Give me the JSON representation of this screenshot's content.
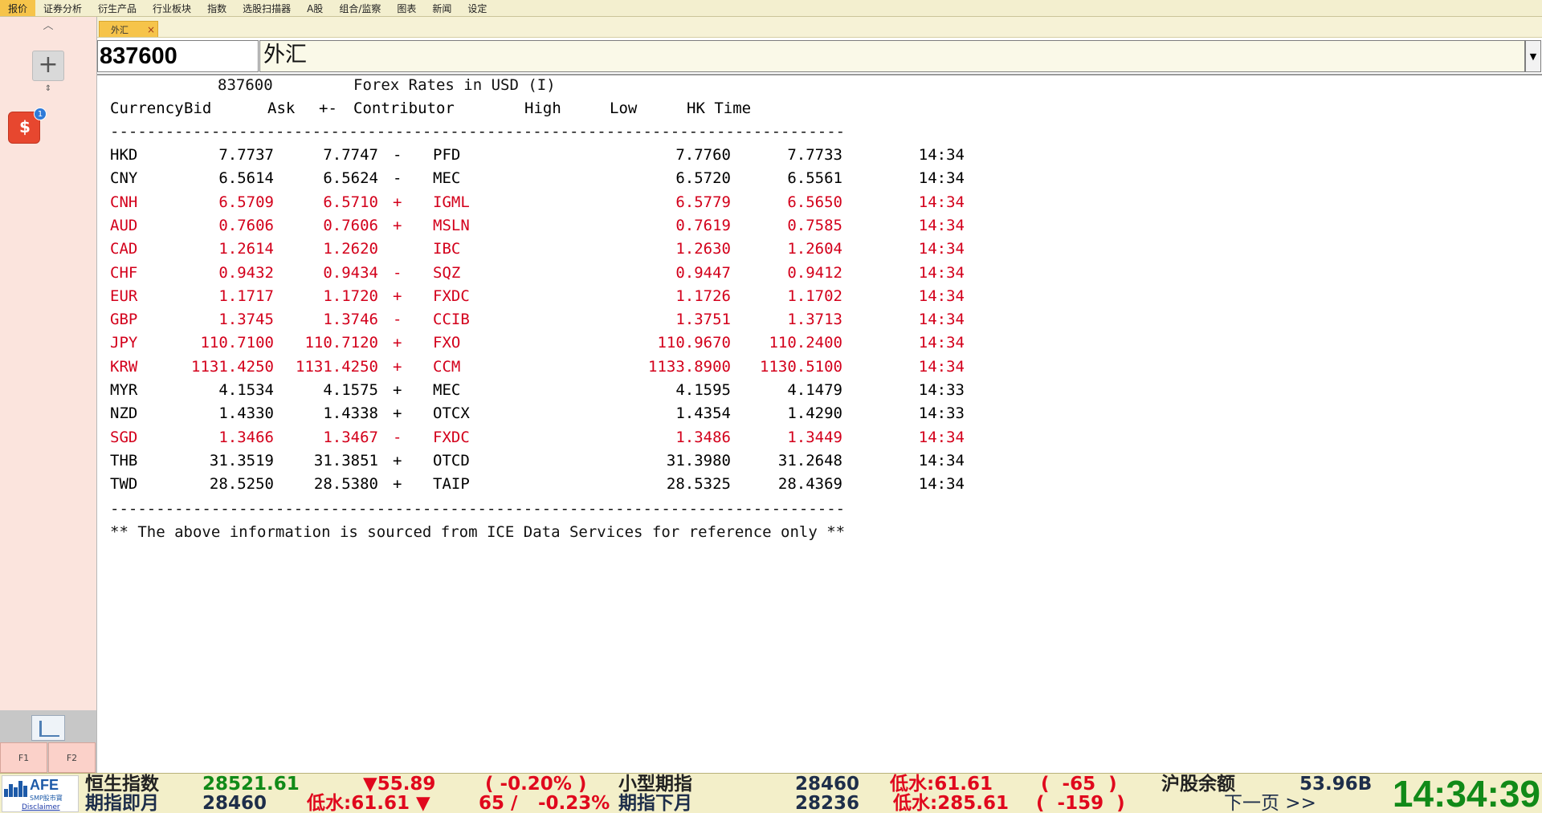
{
  "menu": [
    "报价",
    "证券分析",
    "衍生产品",
    "行业板块",
    "指数",
    "选股扫描器",
    "A股",
    "组合/监察",
    "图表",
    "新闻",
    "设定"
  ],
  "sidebar": {
    "up_glyph": "︿",
    "add_glyph": "+",
    "split_glyph": "⇕",
    "app_glyph": "$",
    "badge": "1",
    "f1": "F1",
    "f2": "F2"
  },
  "tab": {
    "label": "外汇",
    "close": "×"
  },
  "address": {
    "code": "837600",
    "name": "外汇"
  },
  "report": {
    "code": "837600",
    "title": "Forex Rates in USD (I)",
    "headers": {
      "currency": "Currency",
      "bid": "Bid",
      "ask": "Ask",
      "chg": "+-",
      "contributor": "Contributor",
      "high": "High",
      "low": "Low",
      "time": "HK Time"
    },
    "separator": "--------------------------------------------------------------------------------",
    "rows": [
      {
        "cur": "HKD",
        "bid": "7.7737",
        "ask": "7.7747",
        "chg": "-",
        "con": "PFD",
        "high": "7.7760",
        "low": "7.7733",
        "time": "14:34",
        "red": false
      },
      {
        "cur": "CNY",
        "bid": "6.5614",
        "ask": "6.5624",
        "chg": "-",
        "con": "MEC",
        "high": "6.5720",
        "low": "6.5561",
        "time": "14:34",
        "red": false
      },
      {
        "cur": "CNH",
        "bid": "6.5709",
        "ask": "6.5710",
        "chg": "+",
        "con": "IGML",
        "high": "6.5779",
        "low": "6.5650",
        "time": "14:34",
        "red": true
      },
      {
        "cur": "AUD",
        "bid": "0.7606",
        "ask": "0.7606",
        "chg": "+",
        "con": "MSLN",
        "high": "0.7619",
        "low": "0.7585",
        "time": "14:34",
        "red": true
      },
      {
        "cur": "CAD",
        "bid": "1.2614",
        "ask": "1.2620",
        "chg": "",
        "con": "IBC",
        "high": "1.2630",
        "low": "1.2604",
        "time": "14:34",
        "red": true
      },
      {
        "cur": "CHF",
        "bid": "0.9432",
        "ask": "0.9434",
        "chg": "-",
        "con": "SQZ",
        "high": "0.9447",
        "low": "0.9412",
        "time": "14:34",
        "red": true
      },
      {
        "cur": "EUR",
        "bid": "1.1717",
        "ask": "1.1720",
        "chg": "+",
        "con": "FXDC",
        "high": "1.1726",
        "low": "1.1702",
        "time": "14:34",
        "red": true
      },
      {
        "cur": "GBP",
        "bid": "1.3745",
        "ask": "1.3746",
        "chg": "-",
        "con": "CCIB",
        "high": "1.3751",
        "low": "1.3713",
        "time": "14:34",
        "red": true
      },
      {
        "cur": "JPY",
        "bid": "110.7100",
        "ask": "110.7120",
        "chg": "+",
        "con": "FXO",
        "high": "110.9670",
        "low": "110.2400",
        "time": "14:34",
        "red": true
      },
      {
        "cur": "KRW",
        "bid": "1131.4250",
        "ask": "1131.4250",
        "chg": "+",
        "con": "CCM",
        "high": "1133.8900",
        "low": "1130.5100",
        "time": "14:34",
        "red": true
      },
      {
        "cur": "MYR",
        "bid": "4.1534",
        "ask": "4.1575",
        "chg": "+",
        "con": "MEC",
        "high": "4.1595",
        "low": "4.1479",
        "time": "14:33",
        "red": false
      },
      {
        "cur": "NZD",
        "bid": "1.4330",
        "ask": "1.4338",
        "chg": "+",
        "con": "OTCX",
        "high": "1.4354",
        "low": "1.4290",
        "time": "14:33",
        "red": false
      },
      {
        "cur": "SGD",
        "bid": "1.3466",
        "ask": "1.3467",
        "chg": "-",
        "con": "FXDC",
        "high": "1.3486",
        "low": "1.3449",
        "time": "14:34",
        "red": true
      },
      {
        "cur": "THB",
        "bid": "31.3519",
        "ask": "31.3851",
        "chg": "+",
        "con": "OTCD",
        "high": "31.3980",
        "low": "31.2648",
        "time": "14:34",
        "red": false
      },
      {
        "cur": "TWD",
        "bid": "28.5250",
        "ask": "28.5380",
        "chg": "+",
        "con": "TAIP",
        "high": "28.5325",
        "low": "28.4369",
        "time": "14:34",
        "red": false
      }
    ],
    "footer": "** The above information is sourced from ICE Data Services for reference only **"
  },
  "ticker": {
    "logo_text": "AFE",
    "logo_sub": "SMP股市寶",
    "disclaimer": "Disclaimer",
    "hsi_label": "恒生指数",
    "hsi_value": "28521.61",
    "hsi_change": "▼55.89",
    "hsi_pct": "( -0.20% )",
    "mini_label": "小型期指",
    "mini_value": "28460",
    "mini_discount": "低水:61.61",
    "mini_diff": "(  -65  )",
    "sh_label": "沪股余额",
    "sh_value": "53.96B",
    "fut_label": "期指即月",
    "fut_value": "28460",
    "fut_discount": "低水:61.61 ▼",
    "fut_change": "65 /",
    "fut_pct": "-0.23%",
    "next_label": "期指下月",
    "next_value": "28236",
    "next_discount": "低水:285.61",
    "next_diff": "(  -159  )",
    "next_page": "下一页 >>",
    "clock": "14:34:39"
  },
  "colors": {
    "up": "#d3001b",
    "menu_active": "#f6c44a",
    "clock": "#118a18"
  }
}
